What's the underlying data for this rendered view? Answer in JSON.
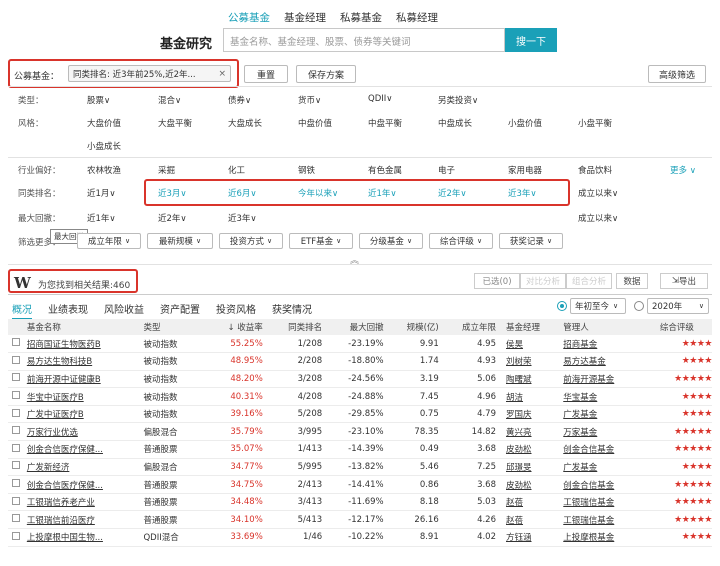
{
  "nav": {
    "tabs": [
      "公募基金",
      "基金经理",
      "私募基金",
      "私募经理"
    ],
    "active": 0
  },
  "search": {
    "title": "基金研究",
    "placeholder": "基金名称、基金经理、股票、债券等关键词",
    "button": "搜一下"
  },
  "filter_bar": {
    "label": "公募基金：",
    "chip": "同类排名: 近3年前25%,近2年...",
    "chip_close": "×",
    "reset": "重置",
    "save": "保存方案",
    "advanced": "高级筛选"
  },
  "rows": {
    "type": {
      "label": "类型：",
      "options": [
        "股票∨",
        "混合∨",
        "债券∨",
        "货币∨",
        "QDII∨",
        "另类投资∨"
      ]
    },
    "style": {
      "label": "风格：",
      "options": [
        "大盘价值",
        "大盘平衡",
        "大盘成长",
        "中盘价值",
        "中盘平衡",
        "中盘成长",
        "小盘价值",
        "小盘平衡",
        "小盘成长"
      ]
    },
    "industry": {
      "label": "行业偏好：",
      "options": [
        "农林牧渔",
        "采掘",
        "化工",
        "钢铁",
        "有色金属",
        "电子",
        "家用电器",
        "食品饮料"
      ],
      "more": "更多 ∨"
    },
    "rank": {
      "label": "同类排名：",
      "options": [
        "近1月∨",
        "近3月∨",
        "近6月∨",
        "今年以来∨",
        "近1年∨",
        "近2年∨",
        "近3年∨",
        "成立以来∨"
      ]
    },
    "drawdown": {
      "label": "最大回撤：",
      "options": [
        "近1年∨",
        "近2年∨",
        "近3年∨",
        "成立以来∨"
      ]
    },
    "filter_more": {
      "label": "筛选更多：",
      "options": [
        "成立年限",
        "最新规模",
        "投资方式",
        "ETF基金",
        "分级基金",
        "综合评级",
        "获奖记录"
      ]
    },
    "tooltip": "最大回撤"
  },
  "results": {
    "logo": "W",
    "text": "为您找到相关结果:460",
    "buttons": [
      "已选(0)",
      "对比分析",
      "组合分析",
      "数据"
    ],
    "export": "导出"
  },
  "tabs": [
    "概况",
    "业绩表现",
    "风险收益",
    "资产配置",
    "投资风格",
    "获奖情况"
  ],
  "period_select": "年初至今",
  "year_select": "2020年",
  "table": {
    "headers": [
      "基金名称",
      "类型",
      "↓ 收益率",
      "同类排名",
      "最大回撤",
      "规模(亿)",
      "成立年限",
      "基金经理",
      "管理人",
      "综合评级"
    ],
    "rows": [
      {
        "name": "招商国证生物医药B",
        "type": "被动指数",
        "ret": "55.25%",
        "rank": "1/208",
        "dd": "-23.19%",
        "size": "9.91",
        "years": "4.95",
        "mgr": "侯昊",
        "co": "招商基金",
        "stars": "★★★★"
      },
      {
        "name": "易方达生物科技B",
        "type": "被动指数",
        "ret": "48.95%",
        "rank": "2/208",
        "dd": "-18.80%",
        "size": "1.74",
        "years": "4.93",
        "mgr": "刘树荣",
        "co": "易方达基金",
        "stars": "★★★★"
      },
      {
        "name": "前海开源中证健康B",
        "type": "被动指数",
        "ret": "48.20%",
        "rank": "3/208",
        "dd": "-24.56%",
        "size": "3.19",
        "years": "5.06",
        "mgr": "陶曙斌",
        "co": "前海开源基金",
        "stars": "★★★★★"
      },
      {
        "name": "华宝中证医疗B",
        "type": "被动指数",
        "ret": "40.31%",
        "rank": "4/208",
        "dd": "-24.88%",
        "size": "7.45",
        "years": "4.96",
        "mgr": "胡洁",
        "co": "华宝基金",
        "stars": "★★★★"
      },
      {
        "name": "广发中证医疗B",
        "type": "被动指数",
        "ret": "39.16%",
        "rank": "5/208",
        "dd": "-29.85%",
        "size": "0.75",
        "years": "4.79",
        "mgr": "罗国庆",
        "co": "广发基金",
        "stars": "★★★★"
      },
      {
        "name": "万家行业优选",
        "type": "偏股混合",
        "ret": "35.79%",
        "rank": "3/995",
        "dd": "-23.10%",
        "size": "78.35",
        "years": "14.82",
        "mgr": "黄兴亮",
        "co": "万家基金",
        "stars": "★★★★★"
      },
      {
        "name": "创金合信医疗保健...",
        "type": "普通股票",
        "ret": "35.07%",
        "rank": "1/413",
        "dd": "-14.39%",
        "size": "0.49",
        "years": "3.68",
        "mgr": "皮劲松",
        "co": "创金合信基金",
        "stars": "★★★★★"
      },
      {
        "name": "广发新经济",
        "type": "偏股混合",
        "ret": "34.77%",
        "rank": "5/995",
        "dd": "-13.82%",
        "size": "5.46",
        "years": "7.25",
        "mgr": "邱璟旻",
        "co": "广发基金",
        "stars": "★★★★"
      },
      {
        "name": "创金合信医疗保健...",
        "type": "普通股票",
        "ret": "34.75%",
        "rank": "2/413",
        "dd": "-14.41%",
        "size": "0.86",
        "years": "3.68",
        "mgr": "皮劲松",
        "co": "创金合信基金",
        "stars": "★★★★★"
      },
      {
        "name": "工银瑞信养老产业",
        "type": "普通股票",
        "ret": "34.48%",
        "rank": "3/413",
        "dd": "-11.69%",
        "size": "8.18",
        "years": "5.03",
        "mgr": "赵蓓",
        "co": "工银瑞信基金",
        "stars": "★★★★★"
      },
      {
        "name": "工银瑞信前沿医疗",
        "type": "普通股票",
        "ret": "34.10%",
        "rank": "5/413",
        "dd": "-12.17%",
        "size": "26.16",
        "years": "4.26",
        "mgr": "赵蓓",
        "co": "工银瑞信基金",
        "stars": "★★★★★"
      },
      {
        "name": "上投摩根中国生物...",
        "type": "QDII混合",
        "ret": "33.69%",
        "rank": "1/46",
        "dd": "-10.22%",
        "size": "8.91",
        "years": "4.02",
        "mgr": "方钰涵",
        "co": "上投摩根基金",
        "stars": "★★★★"
      }
    ]
  },
  "colors": {
    "accent": "#1aa0b8",
    "highlight": "#d9342b",
    "link_blue": "#1aa0b8"
  }
}
